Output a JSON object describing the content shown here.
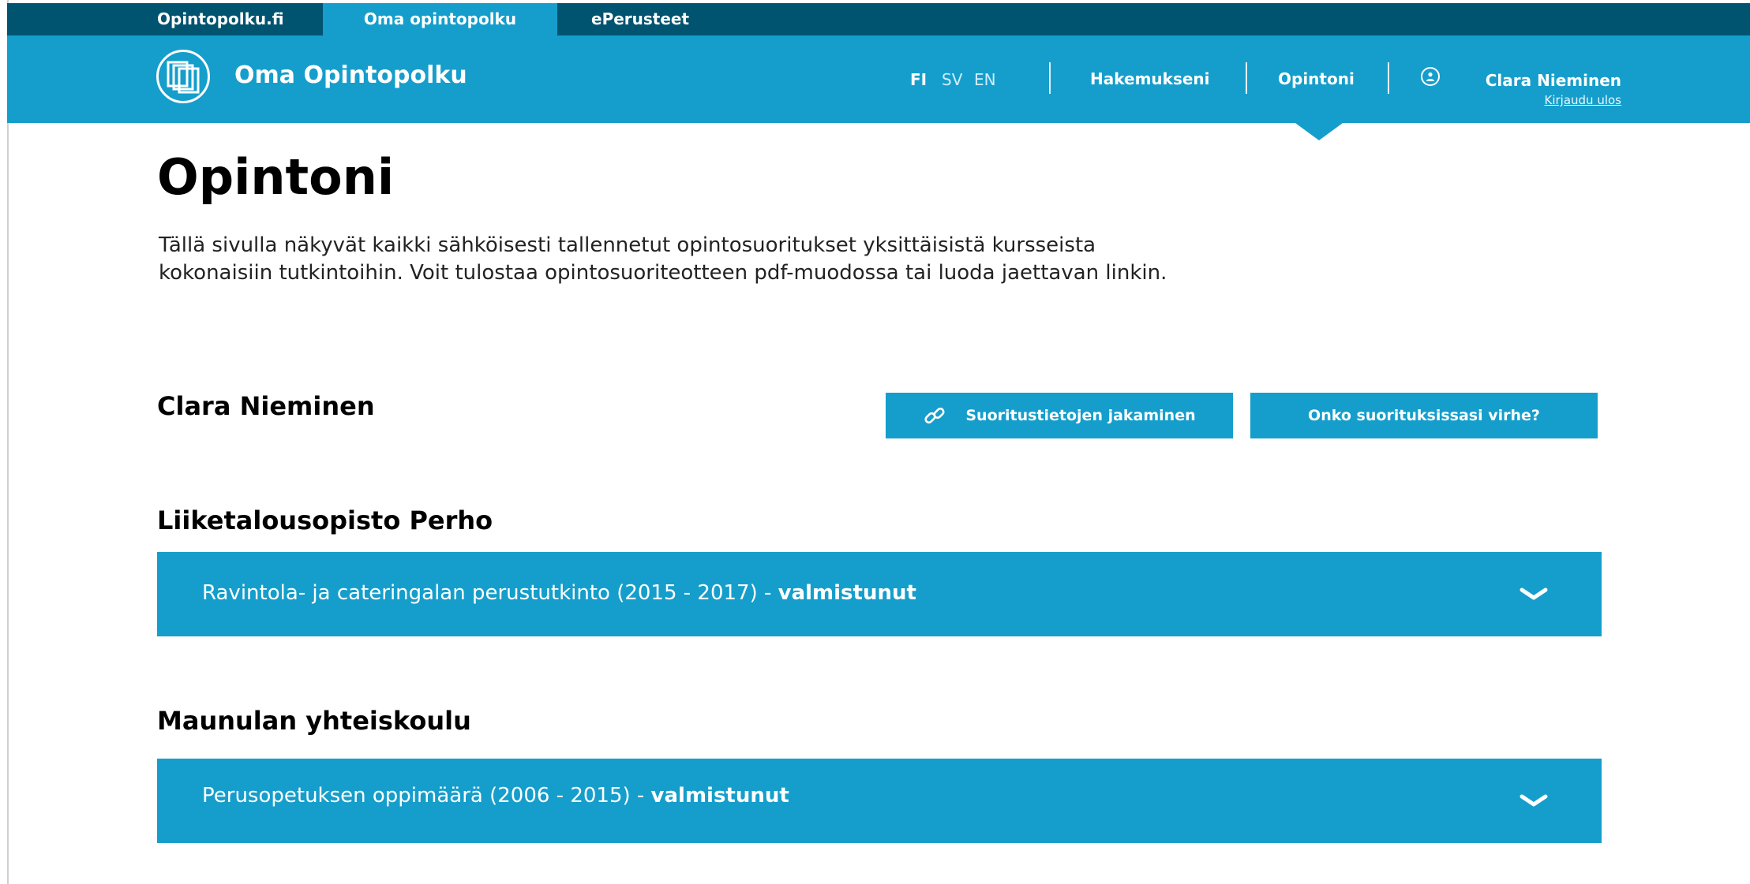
{
  "top_tabs": [
    {
      "label": "Opintopolku.fi",
      "active": false
    },
    {
      "label": "Oma opintopolku",
      "active": true
    },
    {
      "label": "ePerusteet",
      "active": false
    }
  ],
  "header": {
    "brand": "Oma Opintopolku",
    "languages": [
      {
        "code": "FI",
        "active": true
      },
      {
        "code": "SV",
        "active": false
      },
      {
        "code": "EN",
        "active": false
      }
    ],
    "nav": [
      {
        "label": "Hakemukseni",
        "active": false
      },
      {
        "label": "Opintoni",
        "active": true
      }
    ],
    "user": {
      "name": "Clara Nieminen",
      "logout": "Kirjaudu ulos",
      "icon": "user-circle-icon"
    }
  },
  "page": {
    "title": "Opintoni",
    "intro_line1": "Tällä sivulla näkyvät kaikki sähköisesti tallennetut opintosuoritukset yksittäisistä kursseista",
    "intro_line2": "kokonaisiin tutkintoihin. Voit tulostaa opintosuoriteotteen pdf-muodossa tai luoda jaettavan linkin.",
    "student_name": "Clara Nieminen",
    "buttons": {
      "share": {
        "label": "Suoritustietojen jakaminen",
        "icon": "link-icon"
      },
      "error": {
        "label": "Onko suorituksissasi virhe?"
      }
    },
    "schools": [
      {
        "name": "Liiketalousopisto Perho",
        "study": "Ravintola- ja cateringalan perustutkinto (2015 - 2017) - ",
        "status": "valmistunut"
      },
      {
        "name": "Maunulan yhteiskoulu",
        "study": "Perusopetuksen oppimäärä (2006 - 2015) - ",
        "status": "valmistunut"
      }
    ]
  },
  "colors": {
    "dark_blue": "#005470",
    "accent_blue": "#159ecb",
    "white": "#ffffff"
  }
}
